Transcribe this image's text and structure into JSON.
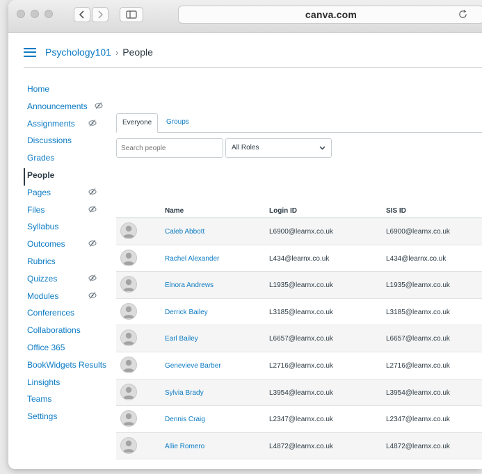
{
  "browser": {
    "url": "canva.com",
    "icons": [
      "back-icon",
      "forward-icon",
      "sidebar-toggle-icon",
      "reload-icon"
    ]
  },
  "breadcrumb": {
    "course": "Psychology101",
    "separator": "›",
    "page": "People"
  },
  "course_nav": {
    "items": [
      {
        "label": "Home",
        "hidden": false
      },
      {
        "label": "Announcements",
        "hidden": true
      },
      {
        "label": "Assignments",
        "hidden": true
      },
      {
        "label": "Discussions",
        "hidden": false
      },
      {
        "label": "Grades",
        "hidden": false
      },
      {
        "label": "People",
        "hidden": false,
        "active": true
      },
      {
        "label": "Pages",
        "hidden": true
      },
      {
        "label": "Files",
        "hidden": true
      },
      {
        "label": "Syllabus",
        "hidden": false
      },
      {
        "label": "Outcomes",
        "hidden": true
      },
      {
        "label": "Rubrics",
        "hidden": false
      },
      {
        "label": "Quizzes",
        "hidden": true
      },
      {
        "label": "Modules",
        "hidden": true
      },
      {
        "label": "Conferences",
        "hidden": false
      },
      {
        "label": "Collaborations",
        "hidden": false
      },
      {
        "label": "Office 365",
        "hidden": false
      },
      {
        "label": "BookWidgets Results",
        "hidden": false
      },
      {
        "label": "Linsights",
        "hidden": false
      },
      {
        "label": "Teams",
        "hidden": false
      },
      {
        "label": "Settings",
        "hidden": false
      }
    ]
  },
  "tabs": [
    {
      "label": "Everyone",
      "active": true
    },
    {
      "label": "Groups",
      "active": false
    }
  ],
  "search": {
    "placeholder": "Search people"
  },
  "role_filter": {
    "selected": "All Roles"
  },
  "table": {
    "columns": [
      "Name",
      "Login ID",
      "SIS ID"
    ],
    "rows": [
      {
        "name": "Caleb Abbott",
        "login": "L6900@learnx.co.uk",
        "sis": "L6900@learnx.co.uk"
      },
      {
        "name": "Rachel Alexander",
        "login": "L434@learnx.co.uk",
        "sis": "L434@learnx.co.uk"
      },
      {
        "name": "Elnora Andrews",
        "login": "L1935@learnx.co.uk",
        "sis": "L1935@learnx.co.uk"
      },
      {
        "name": "Derrick Bailey",
        "login": "L3185@learnx.co.uk",
        "sis": "L3185@learnx.co.uk"
      },
      {
        "name": "Earl Bailey",
        "login": "L6657@learnx.co.uk",
        "sis": "L6657@learnx.co.uk"
      },
      {
        "name": "Genevieve Barber",
        "login": "L2716@learnx.co.uk",
        "sis": "L2716@learnx.co.uk"
      },
      {
        "name": "Sylvia Brady",
        "login": "L3954@learnx.co.uk",
        "sis": "L3954@learnx.co.uk"
      },
      {
        "name": "Dennis Craig",
        "login": "L2347@learnx.co.uk",
        "sis": "L2347@learnx.co.uk"
      },
      {
        "name": "Allie Romero",
        "login": "L4872@learnx.co.uk",
        "sis": "L4872@learnx.co.uk"
      }
    ]
  },
  "colors": {
    "link": "#0c7bc4",
    "text": "#2d3b45",
    "border": "#c7cdd1",
    "row_alt": "#f5f5f5"
  }
}
